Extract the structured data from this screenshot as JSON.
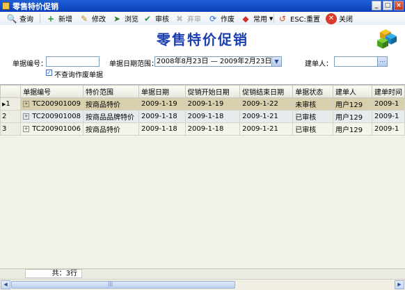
{
  "window": {
    "title": "零售特价促销"
  },
  "toolbar": {
    "query": "查询",
    "add": "新增",
    "edit": "修改",
    "browse": "浏览",
    "approve": "审核",
    "unapprove": "弃审",
    "void": "作废",
    "common": "常用",
    "reset": "ESC:重置",
    "close": "关闭"
  },
  "header": {
    "title": "零售特价促销"
  },
  "filters": {
    "doc_no_label": "单据编号：",
    "doc_no_value": "",
    "date_range_label": "单据日期范围：",
    "date_range_value": "2008年8月23日 — 2009年2月23日",
    "creator_label": "建单人：",
    "creator_value": "",
    "exclude_void_label": "不查询作废单据",
    "exclude_void_checked": true
  },
  "grid": {
    "columns": [
      "单据编号",
      "特价范围",
      "单据日期",
      "促销开始日期",
      "促销结束日期",
      "单据状态",
      "建单人",
      "建单时间"
    ],
    "rows": [
      {
        "num": "1",
        "cells": [
          "TC200901009",
          "按商品特价",
          "2009-1-19",
          "2009-1-19",
          "2009-1-22",
          "未审核",
          "用户129",
          "2009-1"
        ]
      },
      {
        "num": "2",
        "cells": [
          "TC200901008",
          "按商品品牌特价",
          "2009-1-18",
          "2009-1-18",
          "2009-1-21",
          "已审核",
          "用户129",
          "2009-1"
        ]
      },
      {
        "num": "3",
        "cells": [
          "TC200901006",
          "按商品特价",
          "2009-1-18",
          "2009-1-18",
          "2009-1-21",
          "已审核",
          "用户129",
          "2009-1"
        ]
      }
    ],
    "selected_row": 0
  },
  "footer": {
    "count": "共：3行"
  }
}
